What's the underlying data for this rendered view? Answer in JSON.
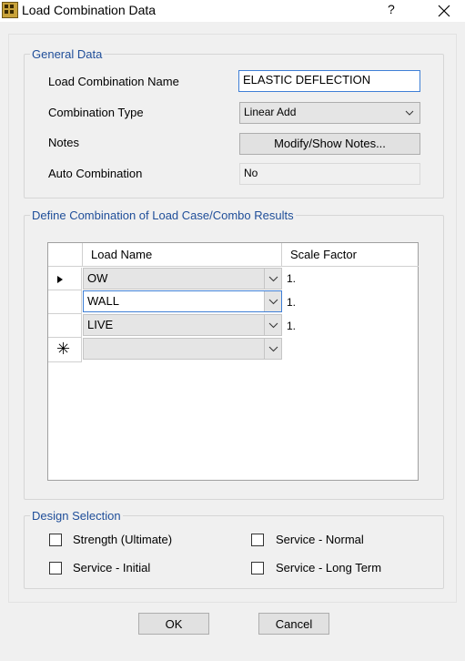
{
  "window": {
    "title": "Load Combination Data",
    "help_label": "?"
  },
  "general": {
    "legend": "General Data",
    "name_label": "Load Combination Name",
    "name_value": "ELASTIC DEFLECTION",
    "type_label": "Combination Type",
    "type_value": "Linear Add",
    "notes_label": "Notes",
    "notes_button": "Modify/Show Notes...",
    "auto_label": "Auto Combination",
    "auto_value": "No"
  },
  "define": {
    "legend": "Define Combination of Load Case/Combo Results",
    "col_load": "Load Name",
    "col_scale": "Scale Factor",
    "rows": [
      {
        "load": "OW",
        "scale": "1."
      },
      {
        "load": "WALL",
        "scale": "1."
      },
      {
        "load": "LIVE",
        "scale": "1."
      },
      {
        "load": "",
        "scale": ""
      }
    ]
  },
  "design": {
    "legend": "Design Selection",
    "strength": "Strength (Ultimate)",
    "service_normal": "Service - Normal",
    "service_initial": "Service - Initial",
    "service_long": "Service - Long Term"
  },
  "buttons": {
    "ok": "OK",
    "cancel": "Cancel"
  },
  "colors": {
    "accent": "#1f4e99",
    "focus": "#3f7fd6"
  }
}
